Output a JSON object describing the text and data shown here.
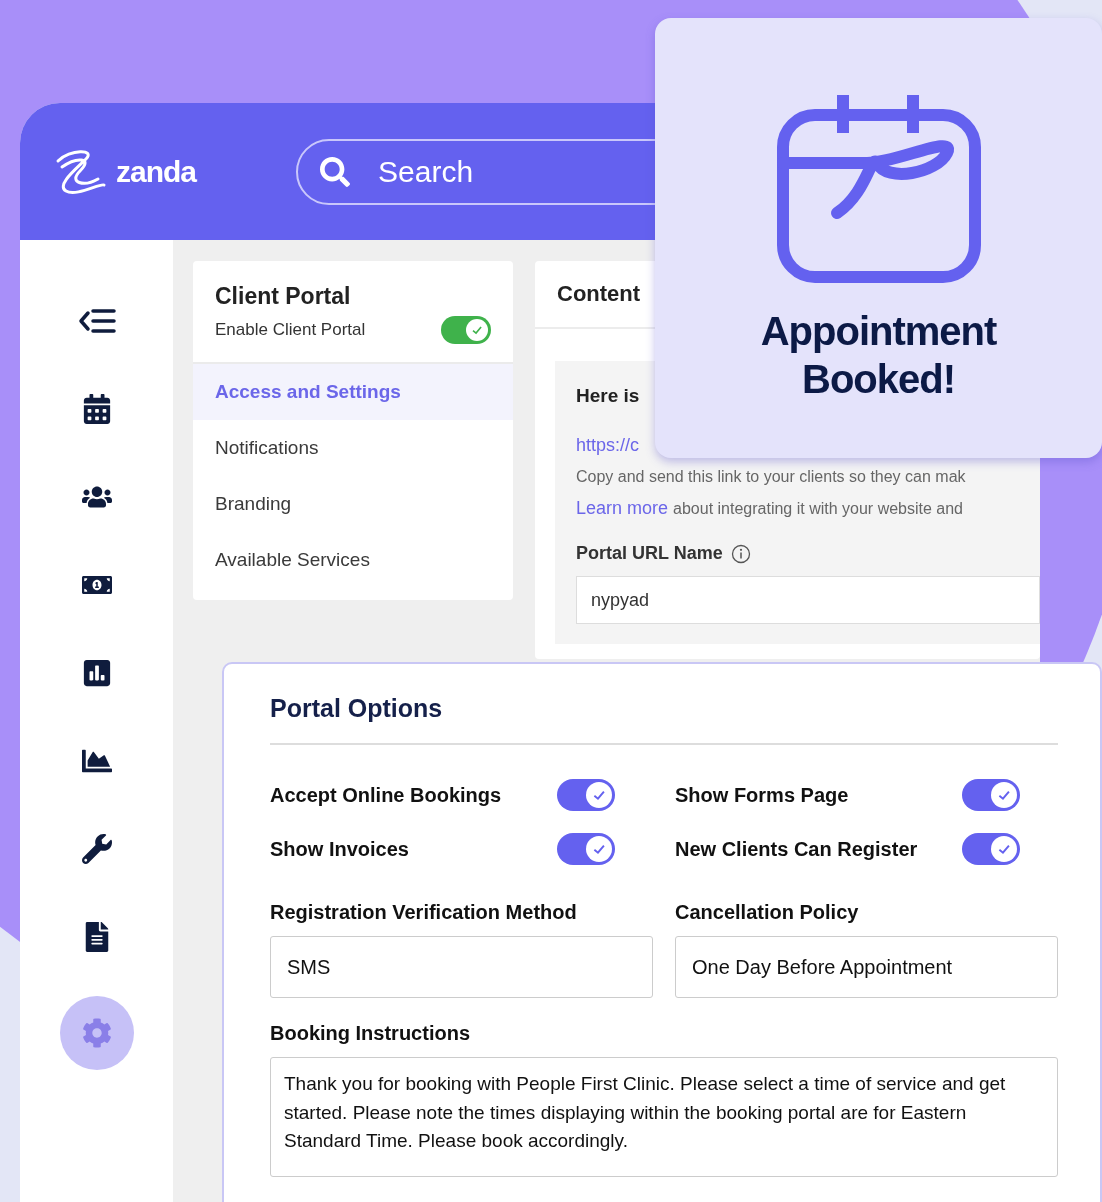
{
  "header": {
    "logo": "zanda",
    "search": {
      "placeholder": "Search"
    }
  },
  "sidebar": {
    "items": [
      {
        "selected": false
      },
      {
        "selected": false
      },
      {
        "selected": false
      },
      {
        "selected": false
      },
      {
        "selected": false
      },
      {
        "selected": false
      },
      {
        "selected": false
      },
      {
        "selected": false
      },
      {
        "selected": true
      }
    ]
  },
  "client_portal": {
    "title": "Client Portal",
    "toggle": {
      "label": "Enable Client Portal",
      "on": true
    },
    "nav": [
      {
        "label": "Access and Settings",
        "selected": true
      },
      {
        "label": "Notifications",
        "selected": false
      },
      {
        "label": "Branding",
        "selected": false
      },
      {
        "label": "Available Services",
        "selected": false
      }
    ]
  },
  "content": {
    "title": "Content",
    "heading": "Here is",
    "link": "https://c",
    "note": "Copy and send this link to your clients so they can mak",
    "learn_more": {
      "link": "Learn more",
      "text": "about integrating it with your website and"
    },
    "url_field": {
      "label": "Portal URL Name",
      "value": "nypyad"
    }
  },
  "notification": {
    "title": "Appointment Booked!"
  },
  "portal_options": {
    "title": "Portal Options",
    "toggles": [
      {
        "label": "Accept Online Bookings",
        "on": true
      },
      {
        "label": "Show Forms Page",
        "on": true
      },
      {
        "label": "Show Invoices",
        "on": true
      },
      {
        "label": "New Clients Can Register",
        "on": true
      }
    ],
    "fields": [
      {
        "label": "Registration Verification Method",
        "value": "SMS"
      },
      {
        "label": "Cancellation Policy",
        "value": "One Day Before Appointment"
      }
    ],
    "instructions": {
      "label": "Booking Instructions",
      "value": "Thank you for booking with People First Clinic. Please select a time of service and get started. Please note the times displaying within the booking portal are for Eastern Standard Time. Please book accordingly."
    }
  }
}
